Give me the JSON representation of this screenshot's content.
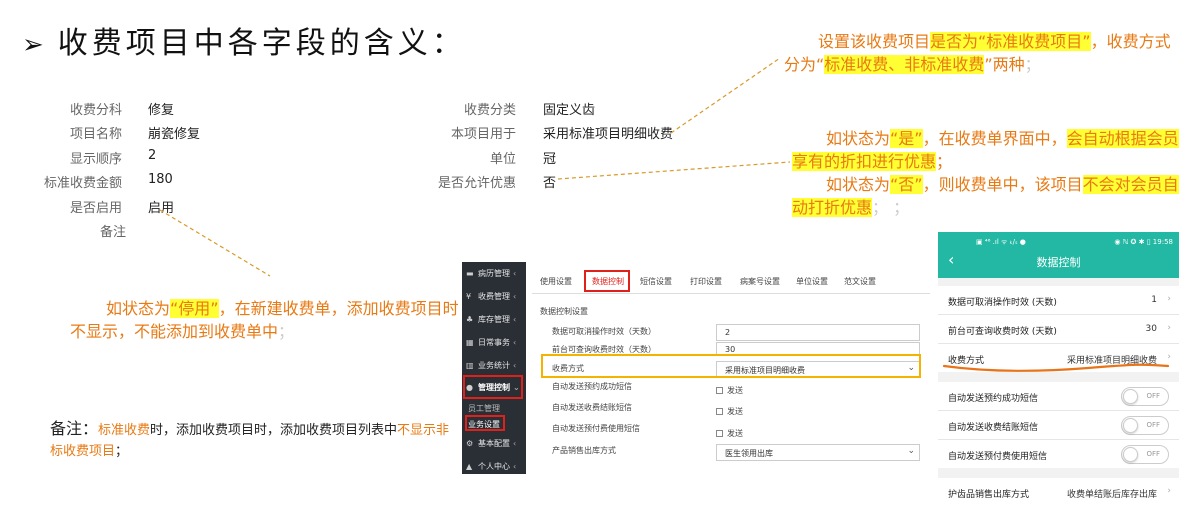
{
  "title": {
    "arrow": "➢",
    "text": "收费项目中各字段的含义："
  },
  "form_left": [
    {
      "label": "收费分科",
      "value": "修复"
    },
    {
      "label": "项目名称",
      "value": "崩瓷修复"
    },
    {
      "label": "显示顺序",
      "value": "2"
    },
    {
      "label": "标准收费金额",
      "value": "180"
    },
    {
      "label": "是否启用",
      "value": "启用"
    },
    {
      "label": "备注",
      "value": ""
    }
  ],
  "form_right": [
    {
      "label": "收费分类",
      "value": "固定义齿"
    },
    {
      "label": "本项目用于",
      "value": "采用标准项目明细收费"
    },
    {
      "label": "单位",
      "value": "冠"
    },
    {
      "label": "是否允许优惠",
      "value": "否"
    }
  ],
  "notes": {
    "n1": {
      "a": "设置该收费项目",
      "b": "是否为“标准收费项目”",
      "c": "，收费方式分为“",
      "d": "标准收费、非标准收费",
      "e": "”两种",
      "f": "；"
    },
    "n2": {
      "a": "如状态为",
      "b": "“是”",
      "c": "，在收费单界面中，",
      "d": "会自动根据会员享有的折扣进行优惠",
      "e": "；"
    },
    "n3": {
      "a": "如状态为",
      "b": "“否”",
      "c": "，则收费单中，该项目",
      "d": "不会对会员自动打折优惠",
      "e": "； ；"
    },
    "n4": {
      "a": "如状态为",
      "b": "“停用”",
      "c": "，在新建收费单，添加收费项目时不显示，不能添加到收费单中",
      "d": "；"
    },
    "n5": {
      "a": "备注：",
      "b": "标准收费",
      "c": "时，添加收费项目时，添加收费项目列表中",
      "d": "不显示非标收费项目",
      "e": "；"
    }
  },
  "web": {
    "sidebar": [
      {
        "icon": "▬",
        "label": "病历管理",
        "caret": "‹"
      },
      {
        "icon": "¥",
        "label": "收费管理",
        "caret": "‹"
      },
      {
        "icon": "♣",
        "label": "库存管理",
        "caret": "‹"
      },
      {
        "icon": "▦",
        "label": "日常事务",
        "caret": "‹"
      },
      {
        "icon": "▥",
        "label": "业务统计",
        "caret": "‹"
      },
      {
        "icon": "●",
        "label": "管理控制",
        "caret": "⌄"
      },
      {
        "icon": "⚙",
        "label": "基本配置",
        "caret": "‹"
      },
      {
        "icon": "▲",
        "label": "个人中心",
        "caret": "‹"
      }
    ],
    "sub": [
      "员工管理",
      "业务设置"
    ],
    "tabs": [
      "使用设置",
      "数据控制",
      "短信设置",
      "打印设置",
      "病案号设置",
      "单位设置",
      "范文设置"
    ],
    "section": "数据控制设置",
    "rows": [
      {
        "label": "数据可取消操作时效（天数）",
        "value": "2"
      },
      {
        "label": "前台可查询收费时效（天数）",
        "value": "30"
      },
      {
        "label": "收费方式",
        "value": "采用标准项目明细收费"
      },
      {
        "label": "自动发送预约成功短信",
        "value": "发送"
      },
      {
        "label": "自动发送收费结账短信",
        "value": "发送"
      },
      {
        "label": "自动发送预付费使用短信",
        "value": "发送"
      },
      {
        "label": "产品销售出库方式",
        "value": "医生领用出库"
      }
    ]
  },
  "phone": {
    "status_left": "▣ ⁴⁶ .ıl ᯤ ₖ/ₛ ●",
    "status_right": "◉ ℕ ✪ ✱ ▯ 19:58",
    "back": "‹",
    "title": "数据控制",
    "rows": [
      {
        "label": "数据可取消操作时效 (天数)",
        "value": "1"
      },
      {
        "label": "前台可查询收费时效 (天数)",
        "value": "30"
      },
      {
        "label": "收费方式",
        "value": "采用标准项目明细收费"
      }
    ],
    "toggles": [
      {
        "label": "自动发送预约成功短信",
        "state": "OFF"
      },
      {
        "label": "自动发送收费结账短信",
        "state": "OFF"
      },
      {
        "label": "自动发送预付费使用短信",
        "state": "OFF"
      }
    ],
    "last": {
      "label": "护齿品销售出库方式",
      "value": "收费单结账后库存出库"
    }
  }
}
